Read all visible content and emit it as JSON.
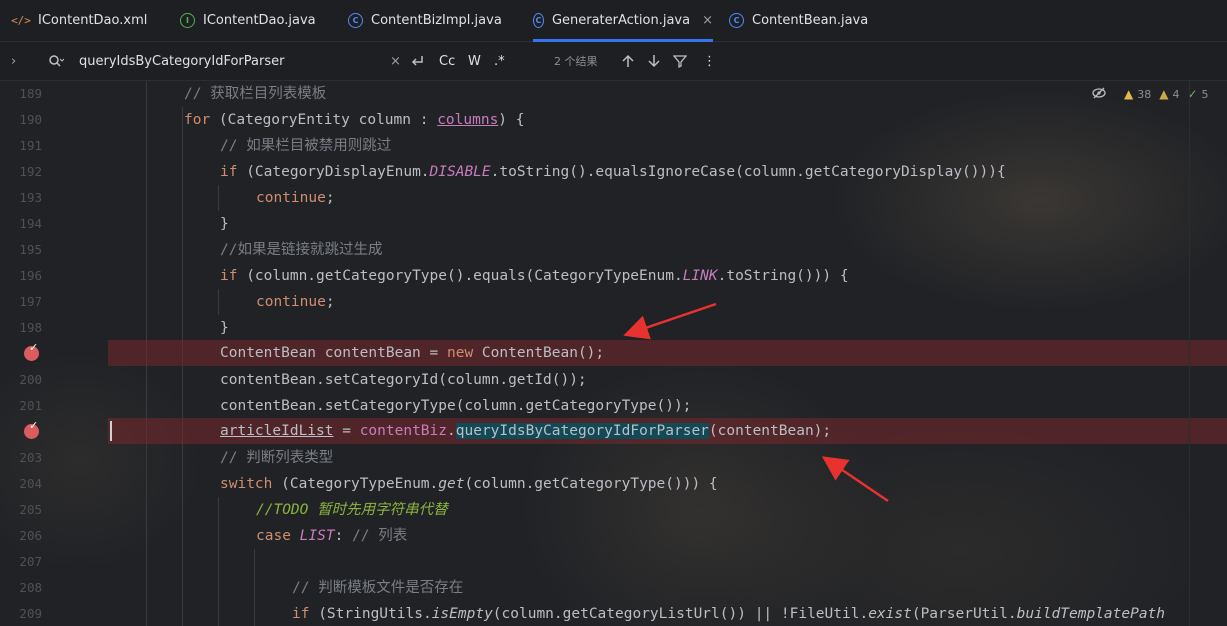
{
  "tabs": [
    {
      "label": "IContentDao.xml",
      "icon": "xml-file-icon"
    },
    {
      "label": "IContentDao.java",
      "icon": "interface-file-icon"
    },
    {
      "label": "ContentBizImpl.java",
      "icon": "class-file-icon"
    },
    {
      "label": "GeneraterAction.java",
      "icon": "class-file-icon",
      "active": true,
      "close": "×"
    },
    {
      "label": "ContentBean.java",
      "icon": "class-file-icon"
    }
  ],
  "search": {
    "query": "queryIdsByCategoryIdForParser",
    "result_count": "2 个结果",
    "case_label": "Cc",
    "word_label": "W",
    "regex_label": ".*",
    "close": "×",
    "more": "⋮"
  },
  "inspections": {
    "warnings": "38",
    "weak_warnings": "4",
    "typos": "5"
  },
  "lines": [
    "189",
    "190",
    "191",
    "192",
    "193",
    "194",
    "195",
    "196",
    "197",
    "198",
    "",
    "200",
    "201",
    "",
    "203",
    "204",
    "205",
    "206",
    "207",
    "208",
    "209"
  ],
  "code": {
    "l189": "// 获取栏目列表模板",
    "l191": "// 如果栏目被禁用则跳过",
    "l195": "//如果是链接就跳过生成",
    "l203": "// 判断列表类型",
    "l205_todo": "//TODO 暂时先用字符串代替",
    "l206_cm": "// 列表",
    "l208": "// 判断模板文件是否存在"
  },
  "colors": {
    "keyword": "#cf8e6d",
    "comment": "#7a7e85",
    "constant": "#c77dbb",
    "breakpoint": "#db5c5c",
    "annotation_arrow": "#e8322f"
  }
}
